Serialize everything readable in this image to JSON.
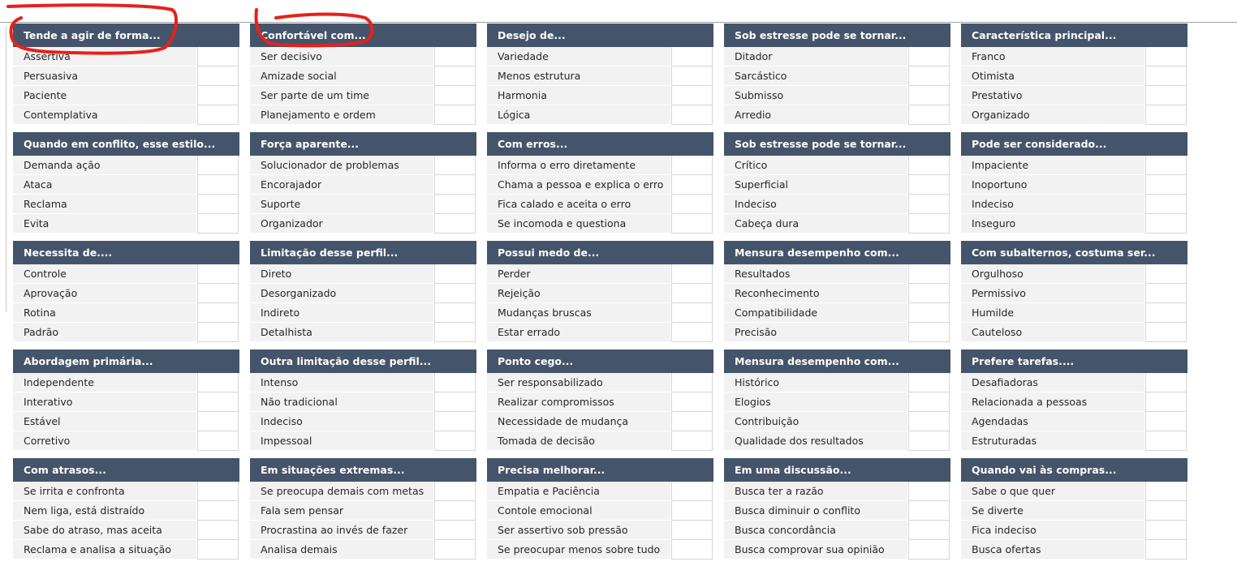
{
  "annotation_color": "#e8201a",
  "header_color": "#44546a",
  "blocks": [
    {
      "title": "Tende a agir de forma...",
      "items": [
        "Assertiva",
        "Persuasiva",
        "Paciente",
        "Contemplativa"
      ]
    },
    {
      "title": "Confortável com...",
      "items": [
        "Ser decisivo",
        "Amizade social",
        "Ser parte de um time",
        "Planejamento e ordem"
      ]
    },
    {
      "title": "Desejo de...",
      "items": [
        "Variedade",
        "Menos estrutura",
        "Harmonia",
        "Lógica"
      ]
    },
    {
      "title": "Sob estresse pode se tornar...",
      "items": [
        "Ditador",
        "Sarcástico",
        "Submisso",
        "Arredio"
      ]
    },
    {
      "title": "Característica principal...",
      "items": [
        "Franco",
        "Otimista",
        "Prestativo",
        "Organizado"
      ]
    },
    {
      "title": "Quando em conflito, esse estilo...",
      "items": [
        "Demanda ação",
        "Ataca",
        "Reclama",
        "Evita"
      ]
    },
    {
      "title": "Força aparente...",
      "items": [
        "Solucionador de problemas",
        "Encorajador",
        "Suporte",
        "Organizador"
      ]
    },
    {
      "title": "Com erros...",
      "items": [
        "Informa o erro diretamente",
        "Chama a pessoa e explica o erro",
        "Fica calado e aceita o erro",
        "Se incomoda e questiona"
      ]
    },
    {
      "title": "Sob estresse pode se tornar...",
      "items": [
        "Crítico",
        "Superficial",
        "Indeciso",
        "Cabeça dura"
      ]
    },
    {
      "title": "Pode ser considerado...",
      "items": [
        "Impaciente",
        "Inoportuno",
        "Indeciso",
        "Inseguro"
      ]
    },
    {
      "title": "Necessita de....",
      "items": [
        "Controle",
        "Aprovação",
        "Rotina",
        "Padrão"
      ]
    },
    {
      "title": "Limitação desse perfil...",
      "items": [
        "Direto",
        "Desorganizado",
        "Indireto",
        "Detalhista"
      ]
    },
    {
      "title": "Possui medo de...",
      "items": [
        "Perder",
        "Rejeição",
        "Mudanças bruscas",
        "Estar errado"
      ]
    },
    {
      "title": "Mensura desempenho com...",
      "items": [
        "Resultados",
        "Reconhecimento",
        "Compatibilidade",
        "Precisão"
      ]
    },
    {
      "title": "Com subalternos, costuma ser...",
      "items": [
        "Orgulhoso",
        "Permissivo",
        "Humilde",
        "Cauteloso"
      ]
    },
    {
      "title": "Abordagem primária...",
      "items": [
        "Independente",
        "Interativo",
        "Estável",
        "Corretivo"
      ]
    },
    {
      "title": "Outra limitação desse perfil...",
      "items": [
        "Intenso",
        "Não tradicional",
        "Indeciso",
        "Impessoal"
      ]
    },
    {
      "title": "Ponto cego...",
      "items": [
        "Ser responsabilizado",
        "Realizar compromissos",
        "Necessidade de mudança",
        "Tomada de decisão"
      ]
    },
    {
      "title": "Mensura desempenho com...",
      "items": [
        "Histórico",
        "Elogios",
        "Contribuição",
        "Qualidade dos resultados"
      ]
    },
    {
      "title": "Prefere tarefas....",
      "items": [
        "Desafiadoras",
        "Relacionada a pessoas",
        "Agendadas",
        "Estruturadas"
      ]
    },
    {
      "title": "Com atrasos...",
      "items": [
        "Se irrita e confronta",
        "Nem liga, está distraído",
        "Sabe do atraso, mas aceita",
        "Reclama e analisa a situação"
      ]
    },
    {
      "title": "Em situações extremas...",
      "items": [
        "Se preocupa demais com metas",
        "Fala sem pensar",
        "Procrastina ao invés de fazer",
        "Analisa demais"
      ]
    },
    {
      "title": "Precisa melhorar...",
      "items": [
        "Empatia e Paciência",
        "Contole emocional",
        "Ser assertivo sob pressão",
        "Se preocupar menos sobre tudo"
      ]
    },
    {
      "title": "Em uma discussão...",
      "items": [
        "Busca ter a razão",
        "Busca diminuir o conflito",
        "Busca concordância",
        "Busca comprovar sua opinião"
      ]
    },
    {
      "title": "Quando vai às compras...",
      "items": [
        "Sabe o que quer",
        "Se diverte",
        "Fica indeciso",
        "Busca ofertas"
      ]
    }
  ]
}
